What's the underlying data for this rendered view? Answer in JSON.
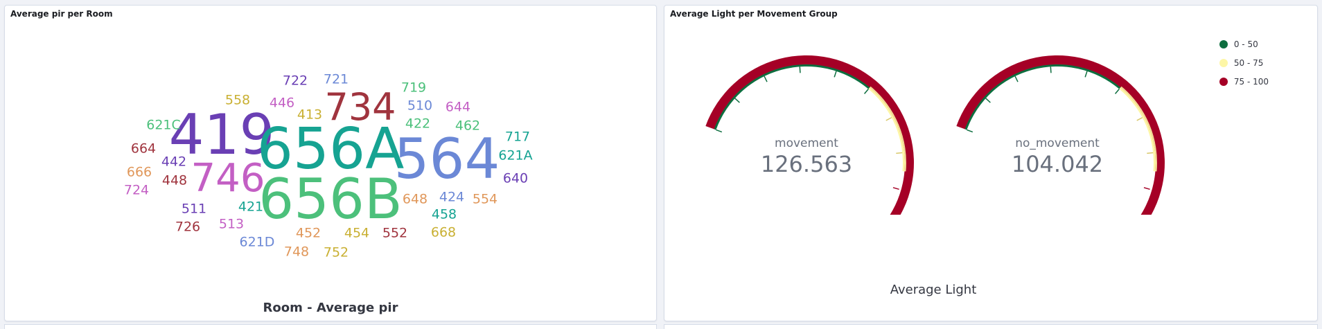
{
  "left_panel": {
    "title": "Average pir per Room",
    "caption": "Room - Average pir",
    "words": [
      {
        "text": "419",
        "color": "#6a3fb4",
        "size": 80
      },
      {
        "text": "734",
        "color": "#a0343e",
        "size": 54
      },
      {
        "text": "656A",
        "color": "#16a392",
        "size": 82
      },
      {
        "text": "656B",
        "color": "#4cc07b",
        "size": 80
      },
      {
        "text": "564",
        "color": "#6b88d6",
        "size": 80
      },
      {
        "text": "746",
        "color": "#c35fc4",
        "size": 56
      },
      {
        "text": "722",
        "color": "#6a3fb4",
        "size": 19
      },
      {
        "text": "721",
        "color": "#6b88d6",
        "size": 19
      },
      {
        "text": "558",
        "color": "#c9b033",
        "size": 19
      },
      {
        "text": "446",
        "color": "#c35fc4",
        "size": 19
      },
      {
        "text": "413",
        "color": "#c9b033",
        "size": 19
      },
      {
        "text": "719",
        "color": "#4cc07b",
        "size": 19
      },
      {
        "text": "510",
        "color": "#6b88d6",
        "size": 19
      },
      {
        "text": "644",
        "color": "#c35fc4",
        "size": 19
      },
      {
        "text": "422",
        "color": "#4cc07b",
        "size": 19
      },
      {
        "text": "462",
        "color": "#4cc07b",
        "size": 19
      },
      {
        "text": "621C",
        "color": "#4cc07b",
        "size": 19
      },
      {
        "text": "664",
        "color": "#a0343e",
        "size": 19
      },
      {
        "text": "717",
        "color": "#16a392",
        "size": 19
      },
      {
        "text": "621A",
        "color": "#16a392",
        "size": 19
      },
      {
        "text": "442",
        "color": "#6a3fb4",
        "size": 19
      },
      {
        "text": "666",
        "color": "#e0975a",
        "size": 19
      },
      {
        "text": "448",
        "color": "#a0343e",
        "size": 19
      },
      {
        "text": "640",
        "color": "#6a3fb4",
        "size": 19
      },
      {
        "text": "724",
        "color": "#c35fc4",
        "size": 19
      },
      {
        "text": "648",
        "color": "#e0975a",
        "size": 19
      },
      {
        "text": "424",
        "color": "#6b88d6",
        "size": 19
      },
      {
        "text": "554",
        "color": "#e0975a",
        "size": 19
      },
      {
        "text": "511",
        "color": "#6a3fb4",
        "size": 19
      },
      {
        "text": "421",
        "color": "#16a392",
        "size": 19
      },
      {
        "text": "458",
        "color": "#16a392",
        "size": 19
      },
      {
        "text": "726",
        "color": "#a0343e",
        "size": 19
      },
      {
        "text": "513",
        "color": "#c35fc4",
        "size": 19
      },
      {
        "text": "452",
        "color": "#e0975a",
        "size": 19
      },
      {
        "text": "454",
        "color": "#c9b033",
        "size": 19
      },
      {
        "text": "552",
        "color": "#a0343e",
        "size": 19
      },
      {
        "text": "668",
        "color": "#c9b033",
        "size": 19
      },
      {
        "text": "621D",
        "color": "#6b88d6",
        "size": 19
      },
      {
        "text": "748",
        "color": "#e0975a",
        "size": 19
      },
      {
        "text": "752",
        "color": "#c9b033",
        "size": 19
      }
    ]
  },
  "right_panel": {
    "title": "Average Light per Movement Group",
    "caption": "Average Light",
    "gauges": [
      {
        "label": "movement",
        "value": "126.563",
        "numeric": 126.563
      },
      {
        "label": "no_movement",
        "value": "104.042",
        "numeric": 104.042
      }
    ],
    "range_max": 100,
    "legend": [
      {
        "label": "0 - 50",
        "color": "#0d6e3f"
      },
      {
        "label": "50 - 75",
        "color": "#fdf6a6"
      },
      {
        "label": "75 - 100",
        "color": "#a50026"
      }
    ]
  }
}
